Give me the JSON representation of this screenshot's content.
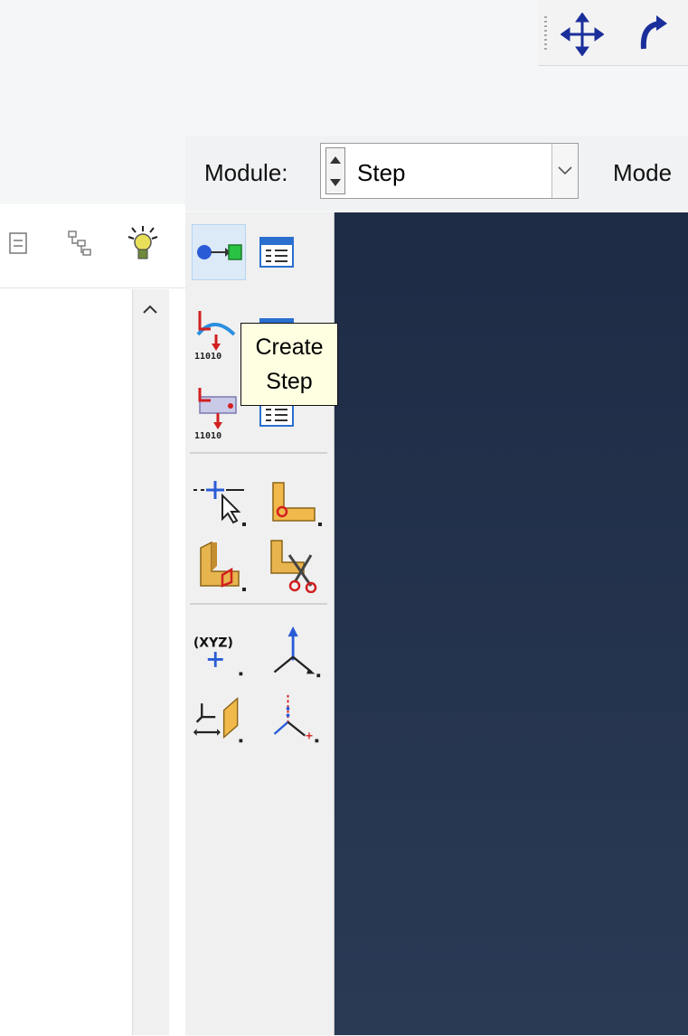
{
  "module_bar": {
    "module_label": "Module:",
    "module_value": "Step",
    "model_label_partial": "Mode"
  },
  "tooltip": {
    "line1": "Create",
    "line2": "Step"
  },
  "palette": {
    "tools": [
      {
        "name": "create-step",
        "icon": "create-step-icon"
      },
      {
        "name": "step-manager",
        "icon": "step-manager-icon"
      },
      {
        "name": "create-field-output",
        "icon": "field-output-icon"
      },
      {
        "name": "field-output-manager",
        "icon": "field-output-manager-icon"
      },
      {
        "name": "create-history-output",
        "icon": "history-output-icon"
      },
      {
        "name": "history-output-manager",
        "icon": "history-output-manager-icon"
      },
      {
        "name": "query-tool",
        "icon": "query-tool-icon"
      },
      {
        "name": "partition-face",
        "icon": "partition-face-icon"
      },
      {
        "name": "partition-cell",
        "icon": "partition-cell-icon"
      },
      {
        "name": "cut-extrude",
        "icon": "scissors-icon"
      },
      {
        "name": "create-datum-point",
        "icon": "datum-point-xyz-icon"
      },
      {
        "name": "create-datum-axis",
        "icon": "datum-axis-icon"
      },
      {
        "name": "create-datum-plane",
        "icon": "datum-plane-icon"
      },
      {
        "name": "create-datum-csys",
        "icon": "datum-csys-icon"
      }
    ],
    "datum_point_text": "(XYZ)",
    "output_code_text": "11010"
  },
  "colors": {
    "viewport_top": "#1e2b45",
    "viewport_bottom": "#2a3a55",
    "tooltip_bg": "#ffffe1",
    "accent_blue": "#2a5bd7"
  }
}
